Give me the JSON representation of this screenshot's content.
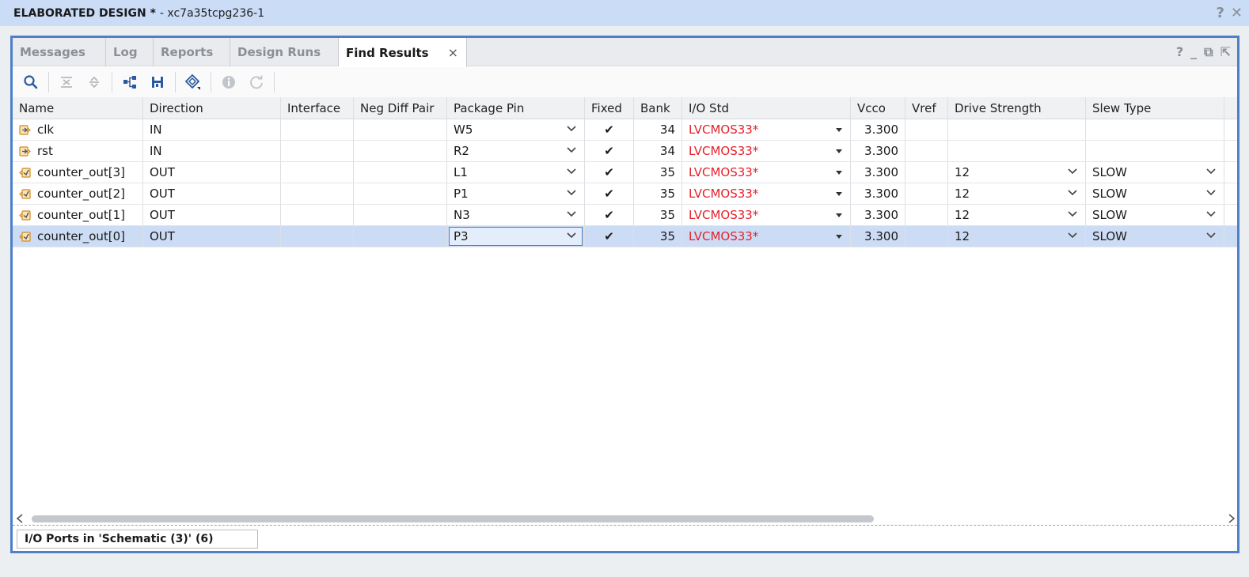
{
  "window": {
    "title_bold": "ELABORATED DESIGN *",
    "title_rest": "- xc7a35tcpg236-1",
    "help_glyph": "?",
    "close_glyph": "✕"
  },
  "tabs": [
    {
      "label": "Messages",
      "active": false
    },
    {
      "label": "Log",
      "active": false
    },
    {
      "label": "Reports",
      "active": false
    },
    {
      "label": "Design Runs",
      "active": false
    },
    {
      "label": "Find Results",
      "active": true
    }
  ],
  "tab_close_glyph": "×",
  "panel_buttons": {
    "help": "?",
    "minimize": "_",
    "restore": "⧉",
    "float": "⇱"
  },
  "toolbar": {
    "icons": [
      "search-icon",
      "collapse-all-icon",
      "expand-all-icon",
      "hierarchy-icon",
      "export-icon",
      "select-icon",
      "info-icon",
      "refresh-icon"
    ]
  },
  "columns": [
    "Name",
    "Direction",
    "Interface",
    "Neg Diff Pair",
    "Package Pin",
    "Fixed",
    "Bank",
    "I/O Std",
    "Vcco",
    "Vref",
    "Drive Strength",
    "Slew Type"
  ],
  "rows": [
    {
      "name": "clk",
      "direction": "IN",
      "interface": "",
      "neg_diff_pair": "",
      "package_pin": "W5",
      "fixed": "✔",
      "bank": "34",
      "io_std": "LVCMOS33*",
      "vcco": "3.300",
      "vref": "",
      "drive_strength": "",
      "slew_type": "",
      "type": "input",
      "selected": false
    },
    {
      "name": "rst",
      "direction": "IN",
      "interface": "",
      "neg_diff_pair": "",
      "package_pin": "R2",
      "fixed": "✔",
      "bank": "34",
      "io_std": "LVCMOS33*",
      "vcco": "3.300",
      "vref": "",
      "drive_strength": "",
      "slew_type": "",
      "type": "input",
      "selected": false
    },
    {
      "name": "counter_out[3]",
      "direction": "OUT",
      "interface": "",
      "neg_diff_pair": "",
      "package_pin": "L1",
      "fixed": "✔",
      "bank": "35",
      "io_std": "LVCMOS33*",
      "vcco": "3.300",
      "vref": "",
      "drive_strength": "12",
      "slew_type": "SLOW",
      "type": "output",
      "selected": false
    },
    {
      "name": "counter_out[2]",
      "direction": "OUT",
      "interface": "",
      "neg_diff_pair": "",
      "package_pin": "P1",
      "fixed": "✔",
      "bank": "35",
      "io_std": "LVCMOS33*",
      "vcco": "3.300",
      "vref": "",
      "drive_strength": "12",
      "slew_type": "SLOW",
      "type": "output",
      "selected": false
    },
    {
      "name": "counter_out[1]",
      "direction": "OUT",
      "interface": "",
      "neg_diff_pair": "",
      "package_pin": "N3",
      "fixed": "✔",
      "bank": "35",
      "io_std": "LVCMOS33*",
      "vcco": "3.300",
      "vref": "",
      "drive_strength": "12",
      "slew_type": "SLOW",
      "type": "output",
      "selected": false
    },
    {
      "name": "counter_out[0]",
      "direction": "OUT",
      "interface": "",
      "neg_diff_pair": "",
      "package_pin": "P3",
      "fixed": "✔",
      "bank": "35",
      "io_std": "LVCMOS33*",
      "vcco": "3.300",
      "vref": "",
      "drive_strength": "12",
      "slew_type": "SLOW",
      "type": "output",
      "selected": true
    }
  ],
  "footer": {
    "tab_label": "I/O Ports in 'Schematic (3)' (6)"
  },
  "colors": {
    "title_bg": "#cbdcf6",
    "panel_border": "#4f7fc6",
    "selected_row": "#cddcf5",
    "io_std_text": "#e8202a",
    "port_icon": "#e8a33b"
  }
}
